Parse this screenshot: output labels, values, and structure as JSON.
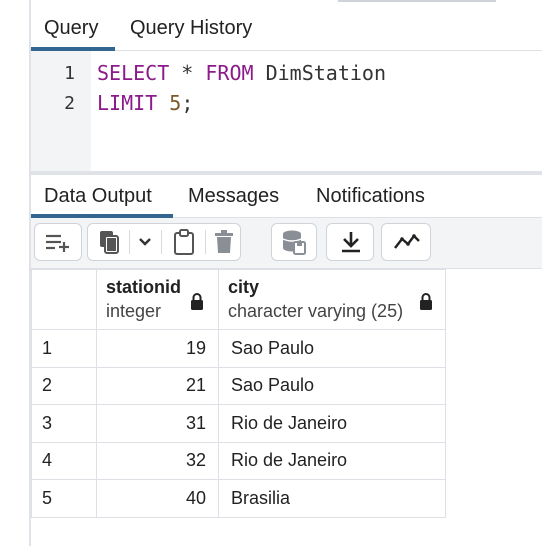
{
  "query_tabs": [
    {
      "label": "Query",
      "active": true
    },
    {
      "label": "Query History",
      "active": false
    }
  ],
  "editor": {
    "line_numbers": [
      "1",
      "2"
    ],
    "line1": {
      "kw1": "SELECT",
      "star": " * ",
      "kw2": "FROM",
      "rest": " DimStation"
    },
    "line2": {
      "kw1": "LIMIT",
      "space": " ",
      "num": "5",
      "semi": ";"
    }
  },
  "output_tabs": [
    {
      "label": "Data Output",
      "active": true
    },
    {
      "label": "Messages",
      "active": false
    },
    {
      "label": "Notifications",
      "active": false
    }
  ],
  "toolbar": {
    "icons": [
      "add-row-icon",
      "copy-icon",
      "chevron-down-icon",
      "paste-icon",
      "delete-icon",
      "save-data-icon",
      "download-icon",
      "graph-icon"
    ]
  },
  "grid": {
    "columns": [
      {
        "name": "stationid",
        "type": "integer",
        "locked": true
      },
      {
        "name": "city",
        "type": "character varying (25)",
        "locked": true
      }
    ],
    "rows": [
      {
        "n": "1",
        "stationid": "19",
        "city": "Sao Paulo"
      },
      {
        "n": "2",
        "stationid": "21",
        "city": "Sao Paulo"
      },
      {
        "n": "3",
        "stationid": "31",
        "city": "Rio de Janeiro"
      },
      {
        "n": "4",
        "stationid": "32",
        "city": "Rio de Janeiro"
      },
      {
        "n": "5",
        "stationid": "40",
        "city": "Brasilia"
      }
    ]
  },
  "colors": {
    "accent": "#326690",
    "keyword": "#8b1a8b",
    "number": "#7a5a2a"
  }
}
